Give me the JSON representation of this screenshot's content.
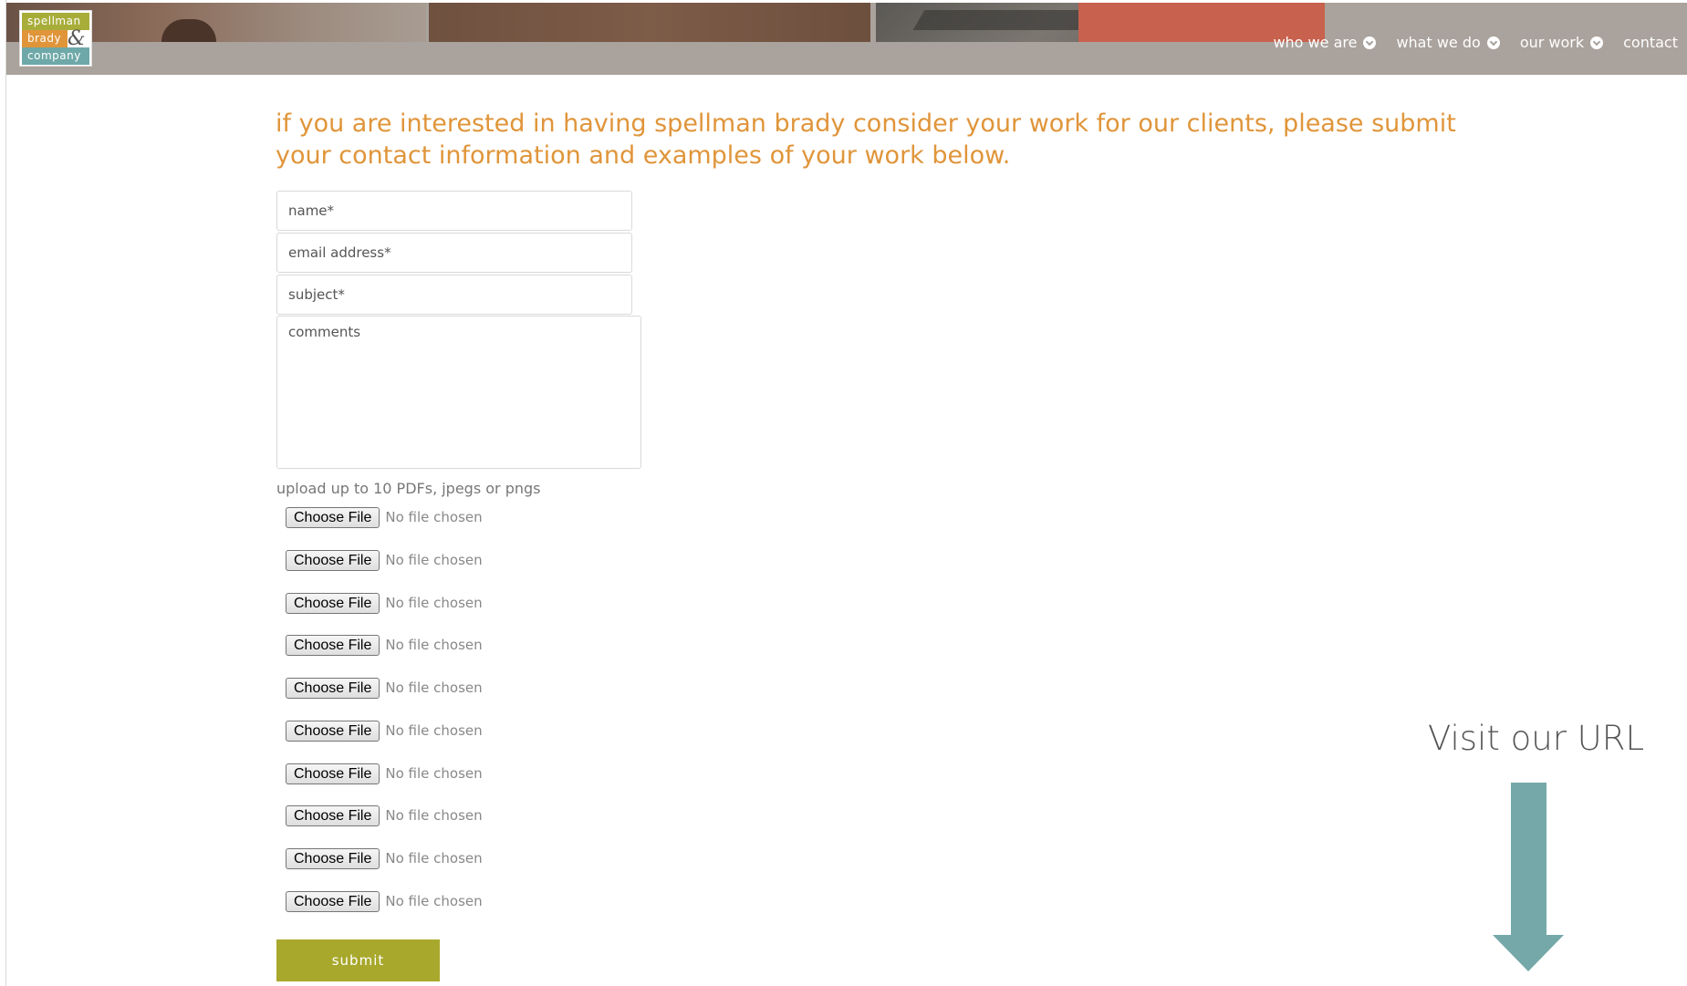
{
  "header": {
    "logo": {
      "line1": "spellman",
      "line2": "brady",
      "ampersand": "&",
      "line3": "company"
    },
    "nav": [
      {
        "label": "who we are",
        "icon": "chevron-down-circle-icon"
      },
      {
        "label": "what we do",
        "icon": "chevron-down-circle-icon"
      },
      {
        "label": "our work",
        "icon": "chevron-down-circle-icon"
      },
      {
        "label": "contact"
      }
    ]
  },
  "main": {
    "intro": "if you are interested in having spellman brady consider your work for our clients, please submit your contact information and examples of your work below.",
    "form": {
      "name_placeholder": "name*",
      "email_placeholder": "email address*",
      "subject_placeholder": "subject*",
      "comments_placeholder": "comments",
      "upload_label": "upload up to 10 PDFs, jpegs or pngs",
      "files": [
        {
          "button": "Choose File",
          "status": "No file chosen"
        },
        {
          "button": "Choose File",
          "status": "No file chosen"
        },
        {
          "button": "Choose File",
          "status": "No file chosen"
        },
        {
          "button": "Choose File",
          "status": "No file chosen"
        },
        {
          "button": "Choose File",
          "status": "No file chosen"
        },
        {
          "button": "Choose File",
          "status": "No file chosen"
        },
        {
          "button": "Choose File",
          "status": "No file chosen"
        },
        {
          "button": "Choose File",
          "status": "No file chosen"
        },
        {
          "button": "Choose File",
          "status": "No file chosen"
        },
        {
          "button": "Choose File",
          "status": "No file chosen"
        }
      ],
      "submit_label": "submit"
    }
  },
  "callout": {
    "text": "Visit our URL",
    "icon": "down-arrow-icon"
  },
  "colors": {
    "accent_orange": "#e0953a",
    "submit_olive": "#a8a82c",
    "arrow_teal": "#75a8a8",
    "header_gray": "#aaa29c"
  }
}
